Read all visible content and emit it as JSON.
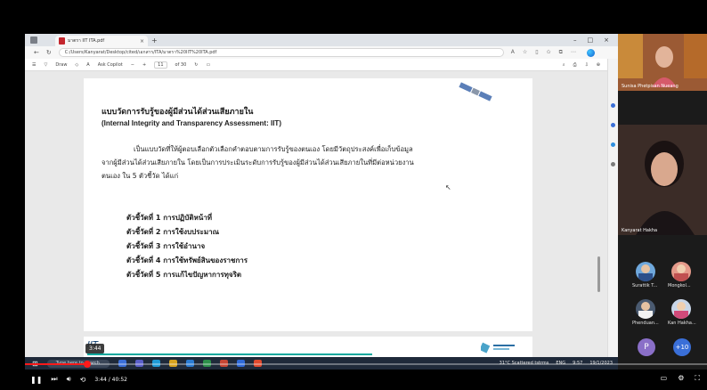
{
  "browser": {
    "tab_title": "มาตรา IIT ITA.pdf",
    "url": "C:/Users/Kanyarat/Desktop/cited/เอกสาร/ITA/มาตรา%20IIT%20ITA.pdf"
  },
  "pdf_toolbar": {
    "draw_label": "Draw",
    "ask_label": "Ask Copilot",
    "page_current": "11",
    "page_total": "of 30"
  },
  "document": {
    "heading_th": "แบบวัดการรับรู้ของผู้มีส่วนได้ส่วนเสียภายใน",
    "heading_en": "(Internal Integrity and Transparency Assessment: IIT)",
    "paragraph_line1": "เป็นแบบวัดที่ให้ผู้ตอบเลือกตัวเลือกคำตอบตามการรับรู้ของตนเอง โดยมีวัตถุประสงค์เพื่อเก็บข้อมูล",
    "paragraph_line2": "จากผู้มีส่วนได้ส่วนเสียภายใน โดยเป็นการประเมินระดับการรับรู้ของผู้มีส่วนได้ส่วนเสียภายในที่มีต่อหน่วยงาน",
    "paragraph_line3": "ตนเอง ใน 5 ตัวชี้วัด ได้แก่",
    "indicators": [
      "ตัวชี้วัดที่ 1 การปฏิบัติหน้าที่",
      "ตัวชี้วัดที่ 2 การใช้งบประมาณ",
      "ตัวชี้วัดที่ 3 การใช้อำนาจ",
      "ตัวชี้วัดที่ 4 การใช้ทรัพย์สินของราชการ",
      "ตัวชี้วัดที่ 5 การแก้ไขปัญหาการทุจริต"
    ],
    "next_page_label": "IIT"
  },
  "taskbar": {
    "search_placeholder": "Type here to search",
    "weather": "31°C Scattered tstrms",
    "lang": "ENG",
    "clock_time": "9:57",
    "clock_date": "19/1/2023"
  },
  "participants": {
    "top_name": "Sunisa Phetpisan Nueang",
    "speaker_name": "Kanyarat Hakha",
    "p1": "Surattik T...",
    "p2": "Mongkol...",
    "p3": "Phenduan...",
    "p4": "Kan Hakha...",
    "p5_initial": "P",
    "more_count": "+10"
  },
  "video": {
    "tooltip_time": "3:44",
    "time_display": "3:44 / 40:52",
    "progress": 0.091
  }
}
